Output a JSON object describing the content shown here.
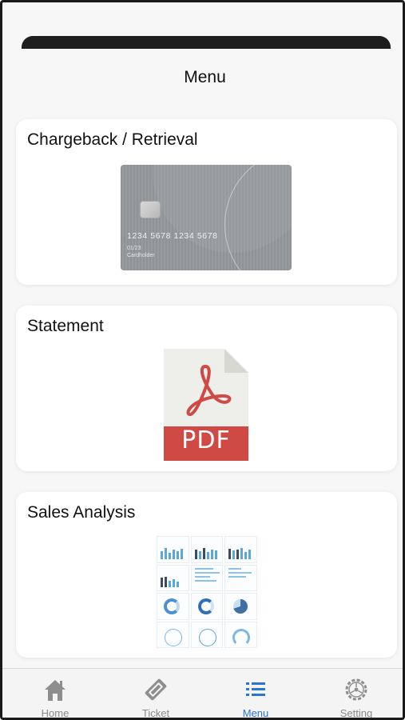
{
  "header": {
    "title": "Menu"
  },
  "cards": [
    {
      "title": "Chargeback / Retrieval",
      "card_number": "1234 5678 1234 5678",
      "valid_thru": "01/23",
      "cardholder": "Cardholder"
    },
    {
      "title": "Statement",
      "badge": "PDF"
    },
    {
      "title": "Sales Analysis"
    }
  ],
  "tabs": [
    {
      "label": "Home",
      "icon": "home-icon",
      "active": false
    },
    {
      "label": "Ticket",
      "icon": "ticket-icon",
      "active": false
    },
    {
      "label": "Menu",
      "icon": "list-icon",
      "active": true
    },
    {
      "label": "Setting",
      "icon": "gear-icon",
      "active": false
    }
  ],
  "colors": {
    "accent": "#2a74d6",
    "inactive": "#8a8a8a",
    "pdf_red": "#d04a45"
  }
}
